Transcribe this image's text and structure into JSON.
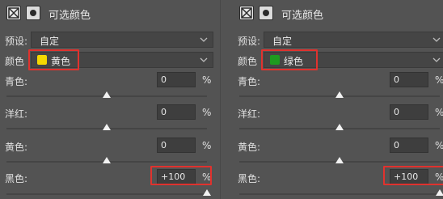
{
  "panels": [
    {
      "title": "可选颜色",
      "preset_label": "预设:",
      "preset_value": "自定",
      "color_label": "颜色",
      "color_name": "黄色",
      "swatch_color": "#f5d800",
      "sliders": [
        {
          "label": "青色:",
          "value": "0",
          "unit": "%",
          "level": 0
        },
        {
          "label": "洋红:",
          "value": "0",
          "unit": "%",
          "level": 0
        },
        {
          "label": "黄色:",
          "value": "0",
          "unit": "%",
          "level": 0
        },
        {
          "label": "黑色:",
          "value": "+100",
          "unit": "%",
          "level": 100
        }
      ]
    },
    {
      "title": "可选颜色",
      "preset_label": "预设:",
      "preset_value": "自定",
      "color_label": "颜色",
      "color_name": "绿色",
      "swatch_color": "#1f9a1f",
      "sliders": [
        {
          "label": "青色:",
          "value": "0",
          "unit": "%",
          "level": 0
        },
        {
          "label": "洋红:",
          "value": "0",
          "unit": "%",
          "level": 0
        },
        {
          "label": "黄色:",
          "value": "0",
          "unit": "%",
          "level": 0
        },
        {
          "label": "黑色:",
          "value": "+100",
          "unit": "%",
          "level": 100
        }
      ]
    }
  ],
  "icons": [
    "selective-color-adjustment-icon",
    "layer-mask-icon",
    "chevron-down-icon"
  ],
  "highlight_color": "#e0322e"
}
